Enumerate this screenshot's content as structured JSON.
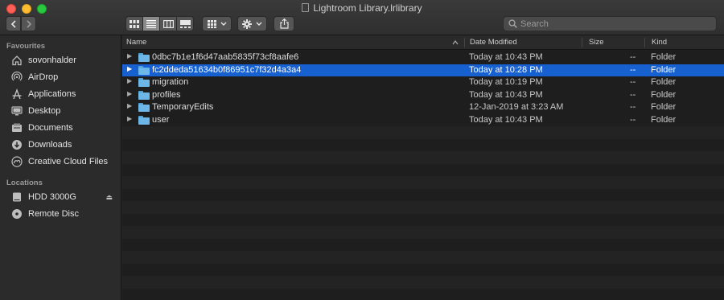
{
  "window": {
    "title": "Lightroom Library.lrlibrary"
  },
  "toolbar": {
    "back_icon": "chevron-left-icon",
    "forward_icon": "chevron-right-icon",
    "view_modes": [
      "icon-view",
      "list-view",
      "column-view",
      "gallery-view"
    ],
    "active_view": "list-view",
    "search_placeholder": "Search"
  },
  "sidebar": {
    "favourites_header": "Favourites",
    "favourites": [
      {
        "label": "sovonhalder",
        "icon": "home-icon"
      },
      {
        "label": "AirDrop",
        "icon": "airdrop-icon"
      },
      {
        "label": "Applications",
        "icon": "applications-icon"
      },
      {
        "label": "Desktop",
        "icon": "desktop-icon"
      },
      {
        "label": "Documents",
        "icon": "documents-icon"
      },
      {
        "label": "Downloads",
        "icon": "downloads-icon"
      },
      {
        "label": "Creative Cloud Files",
        "icon": "creative-cloud-icon"
      }
    ],
    "locations_header": "Locations",
    "locations": [
      {
        "label": "HDD 3000G",
        "icon": "hard-drive-icon"
      },
      {
        "label": "Remote Disc",
        "icon": "disc-icon"
      }
    ]
  },
  "columns": {
    "name": "Name",
    "date": "Date Modified",
    "size": "Size",
    "kind": "Kind"
  },
  "files": [
    {
      "name": "0dbc7b1e1f6d47aab5835f73cf8aafe6",
      "date": "Today at 10:43 PM",
      "size": "--",
      "kind": "Folder"
    },
    {
      "name": "fc2ddeda51634b0f86951c7f32d4a3a4",
      "date": "Today at 10:28 PM",
      "size": "--",
      "kind": "Folder",
      "selected": true
    },
    {
      "name": "migration",
      "date": "Today at 10:19 PM",
      "size": "--",
      "kind": "Folder"
    },
    {
      "name": "profiles",
      "date": "Today at 10:43 PM",
      "size": "--",
      "kind": "Folder"
    },
    {
      "name": "TemporaryEdits",
      "date": "12-Jan-2019 at 3:23 AM",
      "size": "--",
      "kind": "Folder"
    },
    {
      "name": "user",
      "date": "Today at 10:43 PM",
      "size": "--",
      "kind": "Folder"
    }
  ],
  "colors": {
    "selection": "#1760cf",
    "folder": "#6cb7e8"
  }
}
